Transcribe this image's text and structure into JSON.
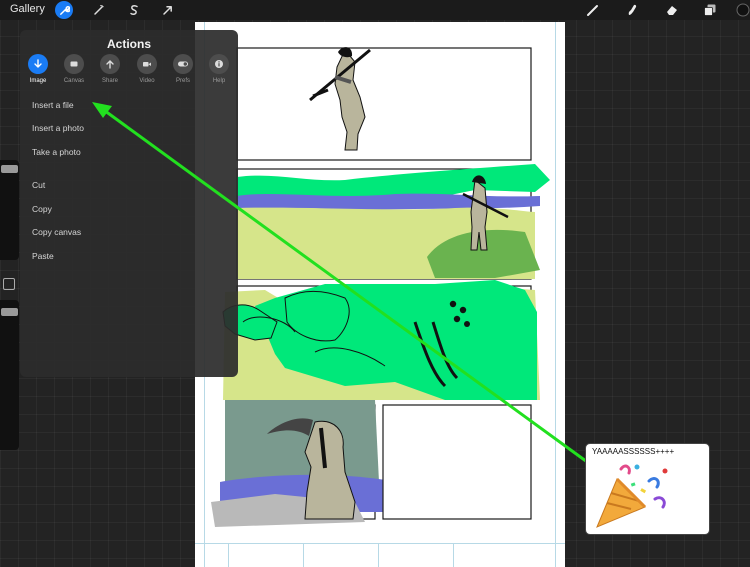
{
  "topbar": {
    "gallery_label": "Gallery"
  },
  "actions_panel": {
    "title": "Actions",
    "tabs": [
      {
        "label": "Image",
        "icon": "download-arrow-icon",
        "active": true
      },
      {
        "label": "Canvas",
        "icon": "canvas-icon"
      },
      {
        "label": "Share",
        "icon": "share-arrow-icon"
      },
      {
        "label": "Video",
        "icon": "video-camera-icon"
      },
      {
        "label": "Prefs",
        "icon": "toggle-icon"
      },
      {
        "label": "Help",
        "icon": "info-icon"
      }
    ],
    "items": [
      "Insert a file",
      "Insert a photo",
      "Take a photo",
      "Cut",
      "Copy",
      "Copy canvas",
      "Paste"
    ]
  },
  "annotation": {
    "caption": "YAAAAASSSSSS++++",
    "emoji": "party-popper",
    "arrow_color": "#22e01f"
  },
  "colors": {
    "accent": "#1a7cf5",
    "panel_bg": "#2c2c2c",
    "highlight_green": "#00e87a",
    "lime": "#d6e58a",
    "violet": "#6a6fd6"
  }
}
